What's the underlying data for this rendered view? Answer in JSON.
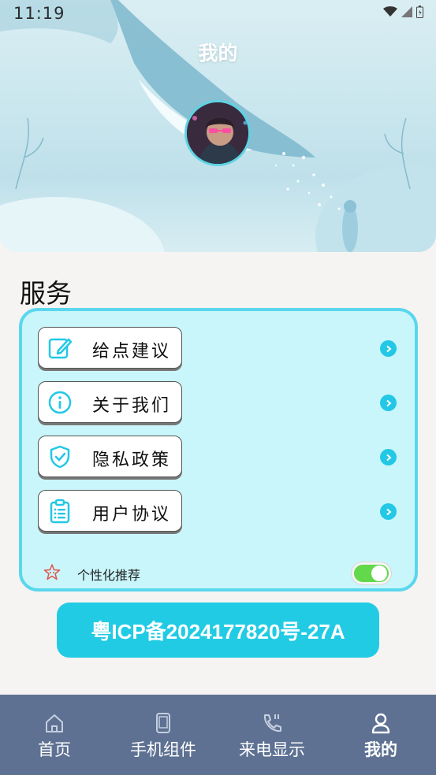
{
  "status_bar": {
    "time": "11:19"
  },
  "header": {
    "title": "我的"
  },
  "services": {
    "title": "服务",
    "items": [
      {
        "label": "给点建议",
        "icon": "edit-icon"
      },
      {
        "label": "关于我们",
        "icon": "info-icon"
      },
      {
        "label": "隐私政策",
        "icon": "shield-check-icon"
      },
      {
        "label": "用户协议",
        "icon": "clipboard-list-icon"
      }
    ],
    "recommend": {
      "label": "个性化推荐",
      "enabled": true
    }
  },
  "icp": "粤ICP备2024177820号-27A",
  "nav": {
    "items": [
      {
        "label": "首页",
        "icon": "home-icon"
      },
      {
        "label": "手机组件",
        "icon": "phone-icon"
      },
      {
        "label": "来电显示",
        "icon": "phone-call-icon"
      },
      {
        "label": "我的",
        "icon": "user-icon",
        "active": true
      }
    ]
  },
  "colors": {
    "accent": "#22cbe4",
    "card_bg": "#c9f6fb",
    "nav_bg": "#5e7192",
    "toggle_on": "#62d84a"
  }
}
